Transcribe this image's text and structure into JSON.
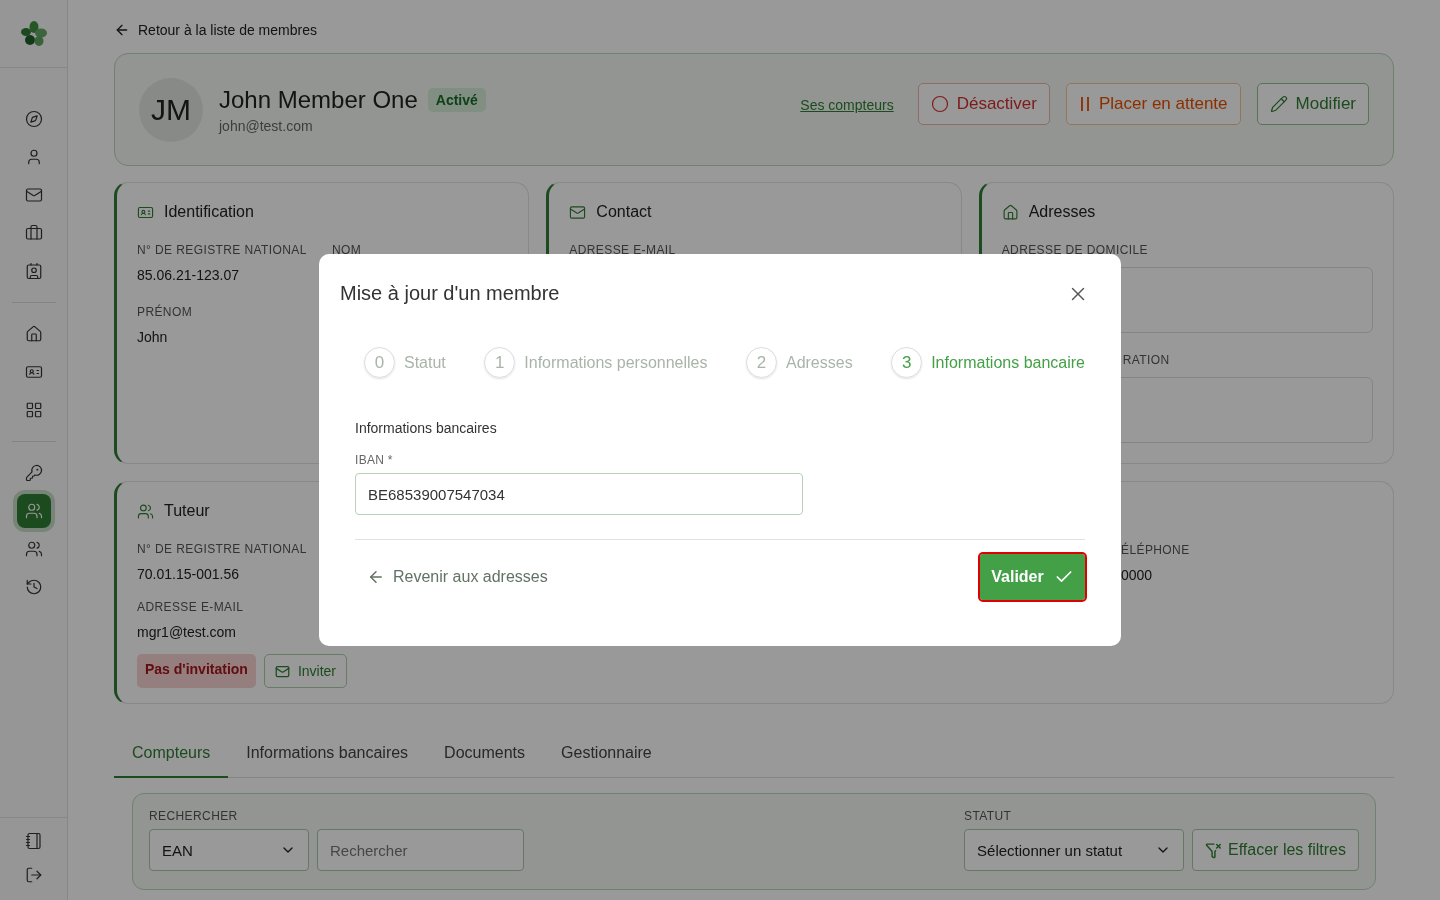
{
  "sidebar": {
    "groups": [
      {
        "items": [
          {
            "selected": false
          },
          {
            "selected": false
          },
          {
            "selected": false
          },
          {
            "selected": false
          },
          {
            "selected": false
          }
        ]
      },
      {
        "items": [
          {
            "selected": false
          },
          {
            "selected": false
          },
          {
            "selected": false
          }
        ]
      },
      {
        "items": [
          {
            "selected": false
          },
          {
            "selected": true
          },
          {
            "selected": false
          },
          {
            "selected": false
          }
        ]
      }
    ]
  },
  "back_link": "Retour à la liste de membres",
  "member": {
    "initials": "JM",
    "name": "John Member One",
    "status": "Activé",
    "email": "john@test.com",
    "link": "Ses compteurs",
    "actions": [
      {
        "kind": "danger",
        "label": "Désactiver"
      },
      {
        "kind": "warning",
        "label": "Placer en attente"
      },
      {
        "kind": "primary",
        "label": "Modifier"
      }
    ]
  },
  "cards": [
    {
      "title": "Identification",
      "fields": [
        {
          "label": "N° DE REGISTRE NATIONAL",
          "value": "85.06.21-123.07"
        },
        {
          "label": "NOM"
        },
        {
          "label": "PRÉNOM",
          "value": "John"
        }
      ]
    },
    {
      "title": "Contact",
      "fields": [
        {
          "label": "ADRESSE E-MAIL"
        }
      ]
    },
    {
      "title": "Adresses",
      "boxes": [
        {
          "label": "ADRESSE DE DOMICILE"
        },
        {
          "label": "RATION"
        }
      ]
    }
  ],
  "guardian": {
    "title": "Tuteur",
    "fields": [
      {
        "label": "N° DE REGISTRE NATIONAL",
        "value": "70.01.15-001.56"
      },
      {
        "label": "ADRESSE E-MAIL",
        "value": "mgr1@test.com"
      }
    ],
    "side_field": {
      "label": "ÉLÉPHONE",
      "value": "0000"
    },
    "invitation": "Pas d'invitation",
    "invite_button": "Inviter"
  },
  "tabs": [
    {
      "label": "Compteurs",
      "selected": true
    },
    {
      "label": "Informations bancaires",
      "selected": false
    },
    {
      "label": "Documents",
      "selected": false
    },
    {
      "label": "Gestionnaire",
      "selected": false
    }
  ],
  "filters": {
    "search_label": "RECHERCHER",
    "search_type": "EAN",
    "search_placeholder": "Rechercher",
    "status_label": "STATUT",
    "status_placeholder": "Sélectionner un statut",
    "clear_button": "Effacer les filtres"
  },
  "modal": {
    "title": "Mise à jour d'un membre",
    "steps": [
      {
        "number": "0",
        "label": "Statut",
        "selected": false
      },
      {
        "number": "1",
        "label": "Informations personnelles",
        "selected": false
      },
      {
        "number": "2",
        "label": "Adresses",
        "selected": false
      },
      {
        "number": "3",
        "label": "Informations bancaire",
        "selected": true
      }
    ],
    "section": "Informations bancaires",
    "field_label": "IBAN *",
    "field_value": "BE68539007547034",
    "back_button": "Revenir aux adresses",
    "submit_button": {
      "label": "Valider",
      "focused": true
    }
  }
}
